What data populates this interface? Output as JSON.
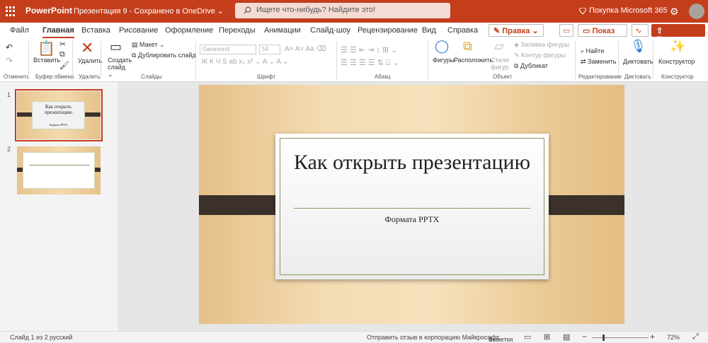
{
  "titlebar": {
    "app_name": "PowerPoint",
    "doc_title": "Презентация 9  -  Сохранено в OneDrive ⌄",
    "search_placeholder": "Ищете что-нибудь? Найдите это!",
    "premium": "Покупка Microsoft 365",
    "accent": "#c43e1c"
  },
  "tabs": [
    "Файл",
    "Главная",
    "Вставка",
    "Рисование",
    "Оформление",
    "Переходы",
    "Анимации",
    "Слайд-шоу",
    "Рецензирование",
    "Вид",
    "Справка"
  ],
  "tab_actions": {
    "edit": "✎ Правка ⌄",
    "show": "Показ",
    "share": "Поделиться"
  },
  "ribbon": {
    "undo_group": "Отменить",
    "clipboard": {
      "paste": "Вставить",
      "group": "Буфер обмена"
    },
    "delete": {
      "label": "Удалить",
      "group": "Удалить"
    },
    "slides": {
      "new_slide": "Создать слайд ⌄",
      "layout": "Макет ⌄",
      "duplicate": "Дублировать слайд",
      "group": "Слайды"
    },
    "font": {
      "family": "Garamond",
      "size": "54",
      "group": "Шрифт"
    },
    "paragraph": {
      "group": "Абзац"
    },
    "object": {
      "shapes": "Фигуры",
      "arrange": "Расположить",
      "styles": "Стили фигур",
      "fill": "Заливка фигуры",
      "outline": "Контур фигуры",
      "duplicate": "Дубликат",
      "group": "Объект"
    },
    "editing": {
      "find": "Найти",
      "replace": "Заменить",
      "group": "Редактирование"
    },
    "dictation": {
      "label": "Диктовать",
      "group": "Диктовать"
    },
    "designer": {
      "label": "Конструктор",
      "group": "Конструктор"
    }
  },
  "slides_panel": [
    {
      "number": "1",
      "title": "Как открыть презентацию",
      "subtitle": "Формата PPTX",
      "selected": true
    },
    {
      "number": "2",
      "selected": false
    }
  ],
  "slide": {
    "title": "Как открыть презентацию",
    "subtitle": "Формата PPTX"
  },
  "statusbar": {
    "slide_count": "Слайд 1 из 2",
    "language": "русский",
    "feedback": "Отправить отзыв в корпорацию Майкрософт",
    "notes": "Заметки",
    "zoom": "72%"
  }
}
